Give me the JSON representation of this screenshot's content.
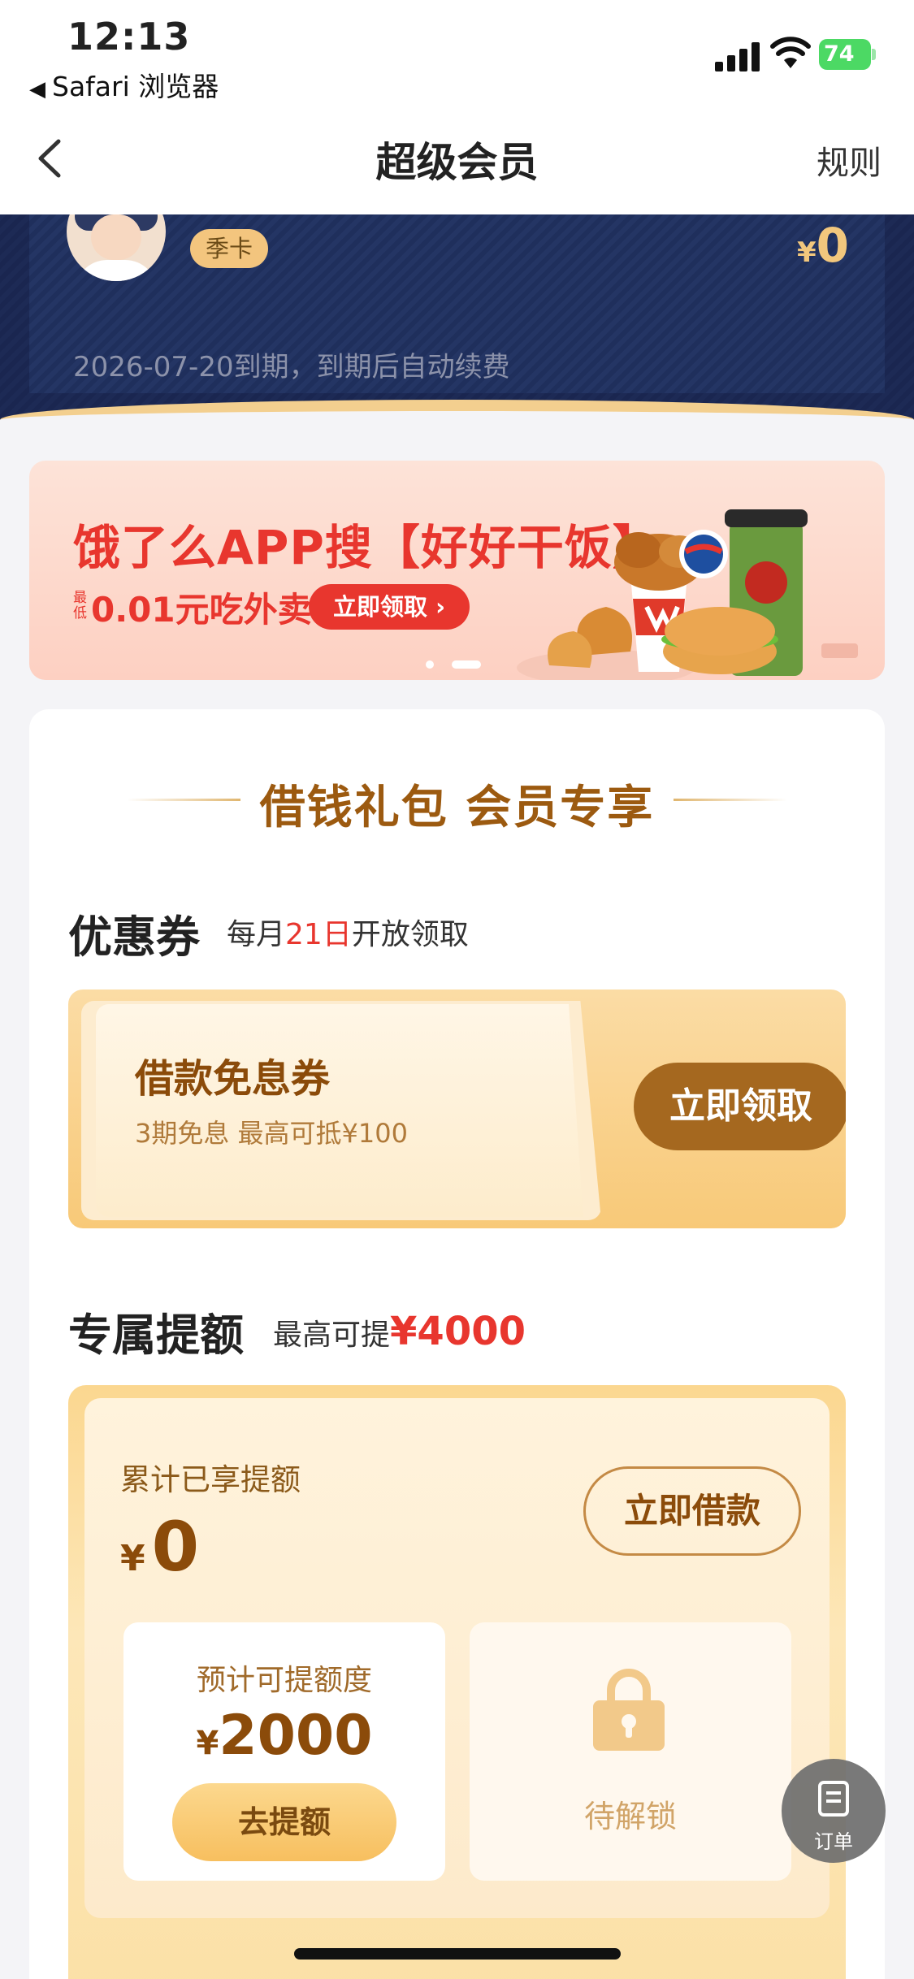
{
  "status_bar": {
    "time": "12:13",
    "back_app": "Safari 浏览器",
    "battery": "74"
  },
  "nav": {
    "title": "超级会员",
    "rule": "规则"
  },
  "member": {
    "badge": "季卡",
    "price_symbol": "¥",
    "price": "0",
    "expire_text": "2026-07-20到期，到期后自动续费"
  },
  "banner": {
    "title": "饿了么APP搜【好好干饭】",
    "min_label": "最低",
    "subtitle": "0.01元吃外卖",
    "button": "立即领取 ›",
    "pages": 2,
    "active_page": 2
  },
  "gift": {
    "heading": "借钱礼包 会员专享",
    "coupon_section": {
      "title": "优惠券",
      "note_prefix": "每月",
      "note_day": "21日",
      "note_suffix": "开放领取",
      "coupon_name": "借款免息券",
      "coupon_desc": "3期免息 最高可抵¥100",
      "coupon_button": "立即领取"
    },
    "quota_section": {
      "title": "专属提额",
      "note_prefix": "最高可提",
      "note_amount": "¥4000",
      "accum_label": "累计已享提额",
      "accum_symbol": "¥",
      "accum_value": "0",
      "borrow_button": "立即借款",
      "est_label": "预计可提额度",
      "est_symbol": "¥",
      "est_value": "2000",
      "raise_button": "去提额",
      "locked_label": "待解锁"
    }
  },
  "fab": {
    "label": "订单"
  },
  "colors": {
    "accent_red": "#e8362e",
    "gold_brown": "#8b4b0a",
    "navy": "#1d2a55"
  }
}
